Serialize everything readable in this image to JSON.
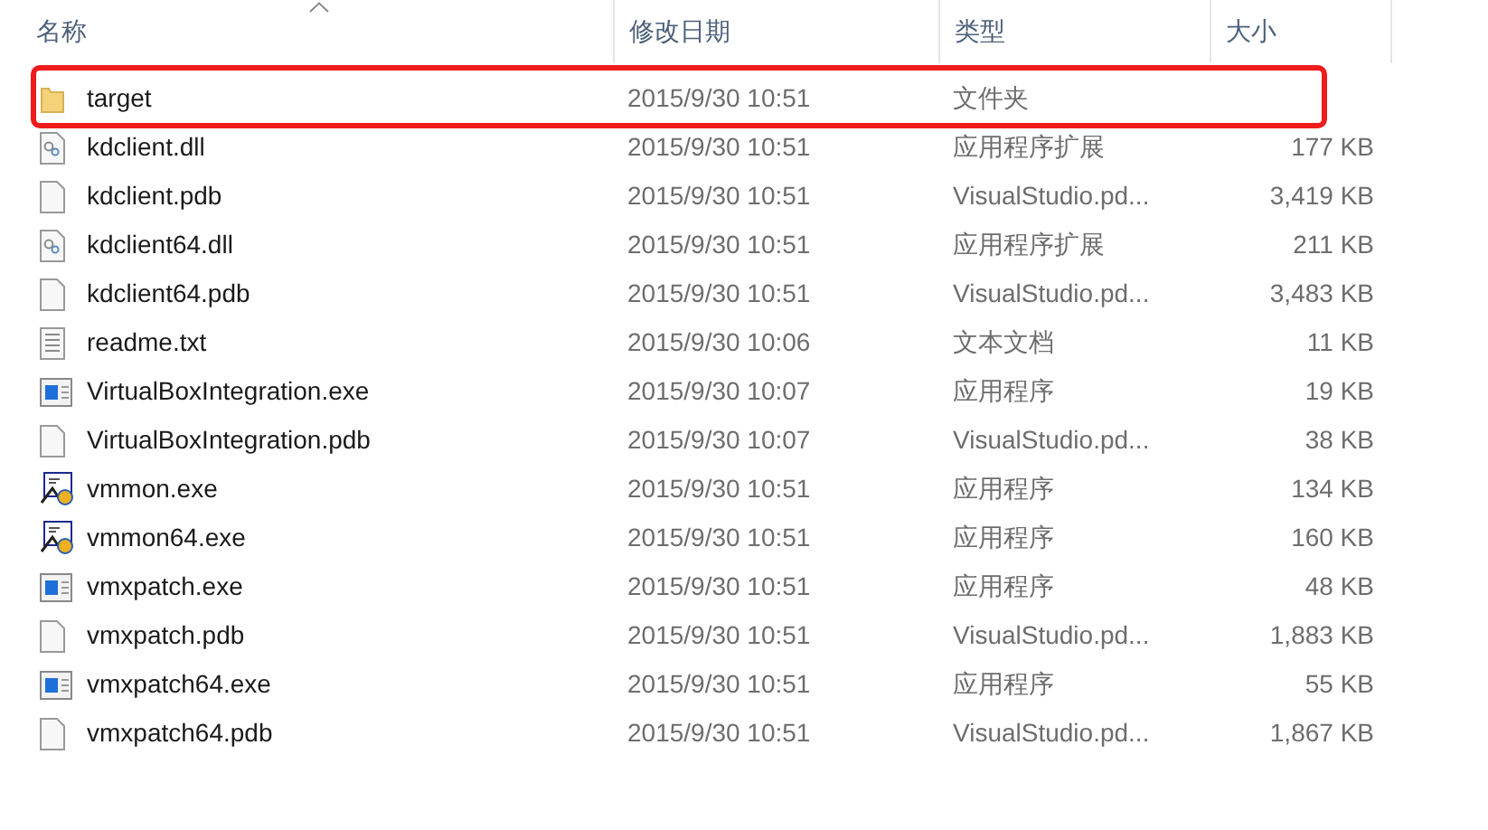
{
  "columns": [
    {
      "label": "名称"
    },
    {
      "label": "修改日期"
    },
    {
      "label": "类型"
    },
    {
      "label": "大小"
    }
  ],
  "rows": [
    {
      "kind": "folder",
      "name": "target",
      "date": "2015/9/30 10:51",
      "type": "文件夹",
      "highlighted": true
    },
    {
      "kind": "dll",
      "name": "kdclient.dll",
      "date": "2015/9/30 10:51",
      "type": "应用程序扩展",
      "size": "177 KB",
      "highlighted": false
    },
    {
      "kind": "blank",
      "name": "kdclient.pdb",
      "date": "2015/9/30 10:51",
      "type": "VisualStudio.pd...",
      "size": "3,419 KB",
      "highlighted": false
    },
    {
      "kind": "dll",
      "name": "kdclient64.dll",
      "date": "2015/9/30 10:51",
      "type": "应用程序扩展",
      "size": "211 KB",
      "highlighted": false
    },
    {
      "kind": "blank",
      "name": "kdclient64.pdb",
      "date": "2015/9/30 10:51",
      "type": "VisualStudio.pd...",
      "size": "3,483 KB",
      "highlighted": false
    },
    {
      "kind": "text",
      "name": "readme.txt",
      "date": "2015/9/30 10:06",
      "type": "文本文档",
      "size": "11 KB",
      "highlighted": false
    },
    {
      "kind": "exe",
      "name": "VirtualBoxIntegration.exe",
      "date": "2015/9/30 10:07",
      "type": "应用程序",
      "size": "19 KB",
      "highlighted": false
    },
    {
      "kind": "blank",
      "name": "VirtualBoxIntegration.pdb",
      "date": "2015/9/30 10:07",
      "type": "VisualStudio.pd...",
      "size": "38 KB",
      "highlighted": false
    },
    {
      "kind": "setup",
      "name": "vmmon.exe",
      "date": "2015/9/30 10:51",
      "type": "应用程序",
      "size": "134 KB",
      "highlighted": false
    },
    {
      "kind": "setup",
      "name": "vmmon64.exe",
      "date": "2015/9/30 10:51",
      "type": "应用程序",
      "size": "160 KB",
      "highlighted": false
    },
    {
      "kind": "exe",
      "name": "vmxpatch.exe",
      "date": "2015/9/30 10:51",
      "type": "应用程序",
      "size": "48 KB",
      "highlighted": false
    },
    {
      "kind": "blank",
      "name": "vmxpatch.pdb",
      "date": "2015/9/30 10:51",
      "type": "VisualStudio.pd...",
      "size": "1,883 KB",
      "highlighted": false
    },
    {
      "kind": "exe",
      "name": "vmxpatch64.exe",
      "date": "2015/9/30 10:51",
      "type": "应用程序",
      "size": "55 KB",
      "highlighted": false
    },
    {
      "kind": "blank",
      "name": "vmxpatch64.pdb",
      "date": "2015/9/30 10:51",
      "type": "VisualStudio.pd...",
      "size": "1,867 KB",
      "highlighted": false
    }
  ]
}
